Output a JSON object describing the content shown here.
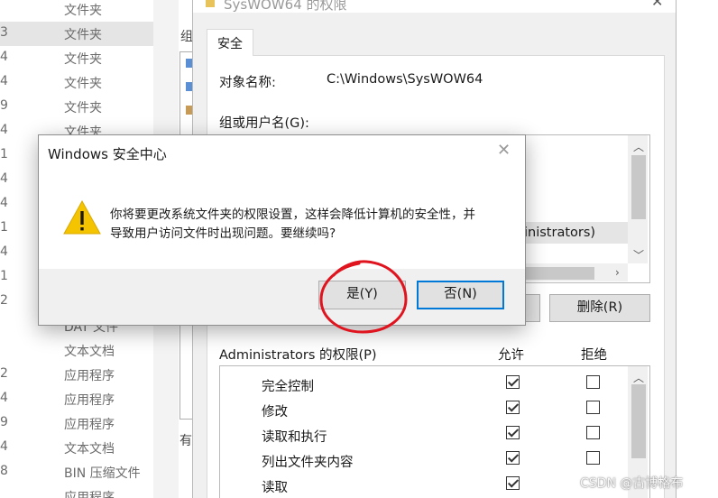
{
  "explorer": {
    "rows": [
      {
        "num": "",
        "type": "文件夹"
      },
      {
        "num": "3",
        "type": "文件夹"
      },
      {
        "num": "4",
        "type": "文件夹"
      },
      {
        "num": "4",
        "type": "文件夹"
      },
      {
        "num": "9",
        "type": "文件夹"
      },
      {
        "num": "4",
        "type": "文件夹"
      },
      {
        "num": "1",
        "type": ""
      },
      {
        "num": "4",
        "type": ""
      },
      {
        "num": "4",
        "type": ""
      },
      {
        "num": "1",
        "type": ""
      },
      {
        "num": "4",
        "type": ""
      },
      {
        "num": "1",
        "type": ""
      },
      {
        "num": "2",
        "type": ""
      },
      {
        "num": "",
        "type": "DAT 文件"
      },
      {
        "num": "",
        "type": "文本文档"
      },
      {
        "num": "2",
        "type": "应用程序"
      },
      {
        "num": "4",
        "type": "应用程序"
      },
      {
        "num": "9",
        "type": "应用程序"
      },
      {
        "num": "4",
        "type": "文本文档"
      },
      {
        "num": "8",
        "type": "BIN 压缩文件"
      },
      {
        "num": "",
        "type": "应用程序"
      }
    ],
    "mid_label_top": "组",
    "mid_label_bottom": "有"
  },
  "properties": {
    "title": "SysWOW64 的权限",
    "tab": "安全",
    "object_label": "对象名称:",
    "object_value": "C:\\Windows\\SysWOW64",
    "group_label": "组或用户名(G):",
    "selected_user_partial": "inistrators)",
    "remove_button": "删除(R)",
    "perm_header": "Administrators 的权限(P)",
    "allow_header": "允许",
    "deny_header": "拒绝",
    "permissions": [
      {
        "name": "完全控制",
        "allow": true,
        "deny": false
      },
      {
        "name": "修改",
        "allow": true,
        "deny": false
      },
      {
        "name": "读取和执行",
        "allow": true,
        "deny": false
      },
      {
        "name": "列出文件夹内容",
        "allow": true,
        "deny": false
      },
      {
        "name": "读取",
        "allow": true,
        "deny": false
      }
    ]
  },
  "dialog": {
    "title": "Windows 安全中心",
    "message_line1": "你将要更改系统文件夹的权限设置，这样会降低计算机的安全性，并",
    "message_line2": "导致用户访问文件时出现问题。要继续吗?",
    "yes_button": "是(Y)",
    "no_button": "否(N)"
  },
  "watermark": "CSDN @古博格布",
  "colors": {
    "focus_blue": "#0078d7",
    "annotation_red": "#e0141e",
    "warning_yellow": "#f5c400"
  }
}
